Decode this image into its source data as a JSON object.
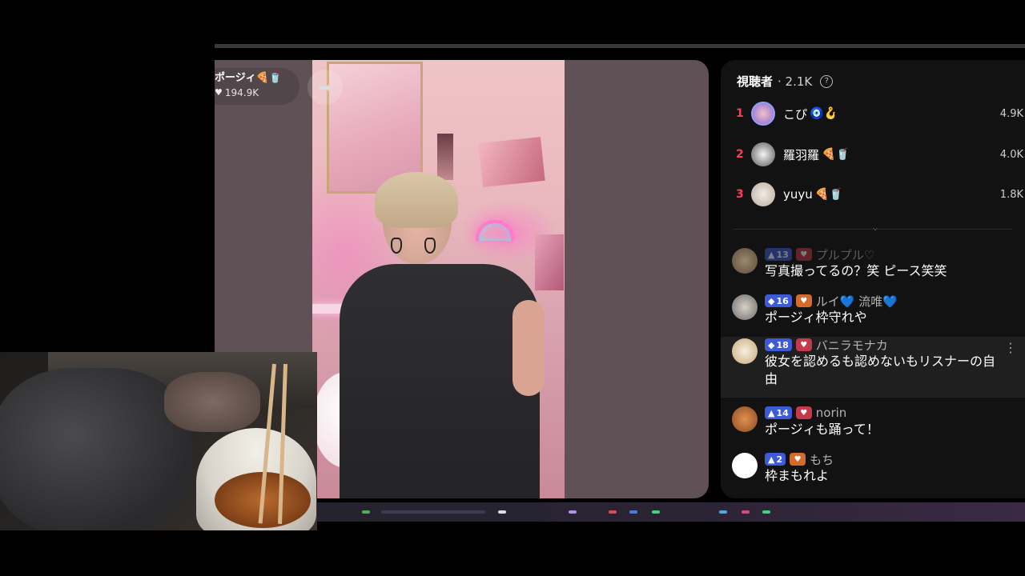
{
  "stream": {
    "creator_name": "ポージィ🍕🥤",
    "likes": "194.9K"
  },
  "viewers": {
    "title": "視聴者",
    "count": "· 2.1K",
    "top": [
      {
        "rank": "1",
        "name": "こぴ",
        "emoji": "🧿🪝",
        "score": "4.9K"
      },
      {
        "rank": "2",
        "name": "羅羽羅",
        "emoji": "🍕🥤",
        "score": "4.0K"
      },
      {
        "rank": "3",
        "name": "yuyu",
        "emoji": "🍕🥤",
        "score": "1.8K"
      }
    ]
  },
  "comments": [
    {
      "level": "13",
      "user": "プルプル♡",
      "text": "写真撮ってるの？笑 ピース笑笑"
    },
    {
      "level": "16",
      "user": "ルイ💙 流唯💙",
      "text": "ポージィ枠守れや"
    },
    {
      "level": "18",
      "user": "バニラモナカ",
      "text": "彼女を認めるも認めないもリスナーの自由"
    },
    {
      "level": "14",
      "user": "norin",
      "text": "ポージィも踊って！"
    },
    {
      "level": "2",
      "user": "もち",
      "text": "枠まもれよ"
    }
  ],
  "icons": {
    "heart": "heart-icon",
    "share": "share-icon",
    "help": "help-icon",
    "expand": "chevron-down-icon",
    "more": "more-vertical-icon"
  },
  "colors": {
    "rank": "#ff3b5c",
    "level_badge": "#3d5bd9",
    "fan_badge": "#c23a4b",
    "chat_bg": "#121212",
    "stream_bg": "#5f5156"
  }
}
